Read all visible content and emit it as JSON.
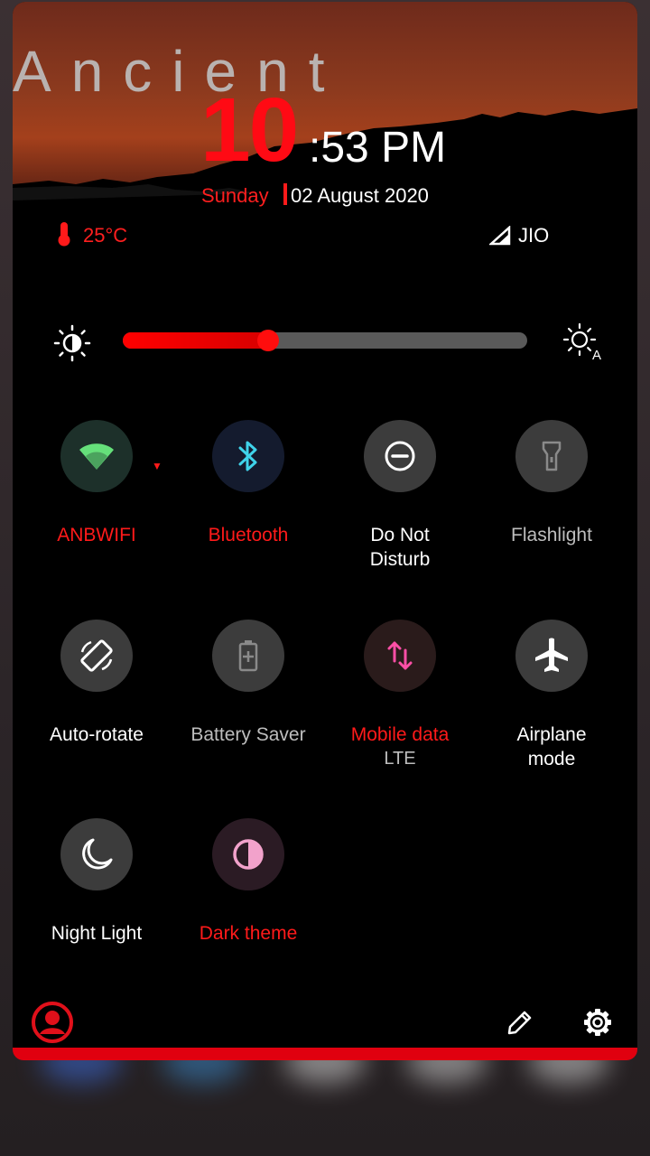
{
  "header": {
    "wallpaper_text": "Ancient",
    "clock_hour": "10",
    "clock_rest": ":53 PM",
    "day": "Sunday",
    "date": "02 August 2020",
    "temperature": "25°C",
    "carrier": "JIO"
  },
  "brightness": {
    "level": 0.36
  },
  "tiles": [
    {
      "label": "ANBWIFI",
      "sub": "",
      "icon": "wifi-icon",
      "active": true
    },
    {
      "label": "Bluetooth",
      "sub": "",
      "icon": "bluetooth-icon",
      "active": true
    },
    {
      "label": "Do Not Disturb",
      "sub": "",
      "icon": "do-not-disturb-icon",
      "active": false
    },
    {
      "label": "Flashlight",
      "sub": "",
      "icon": "flashlight-icon",
      "active": false
    },
    {
      "label": "Auto-rotate",
      "sub": "",
      "icon": "auto-rotate-icon",
      "active": false
    },
    {
      "label": "Battery Saver",
      "sub": "",
      "icon": "battery-saver-icon",
      "active": false
    },
    {
      "label": "Mobile data",
      "sub": "LTE",
      "icon": "mobile-data-icon",
      "active": true
    },
    {
      "label": "Airplane mode",
      "sub": "",
      "icon": "airplane-icon",
      "active": false
    },
    {
      "label": "Night Light",
      "sub": "",
      "icon": "night-light-icon",
      "active": false
    },
    {
      "label": "Dark theme",
      "sub": "",
      "icon": "dark-theme-icon",
      "active": true
    }
  ],
  "colors": {
    "accent": "#ff1a1a",
    "active_label": "#ff1a1a",
    "inactive_circle": "#3c3c3c"
  }
}
